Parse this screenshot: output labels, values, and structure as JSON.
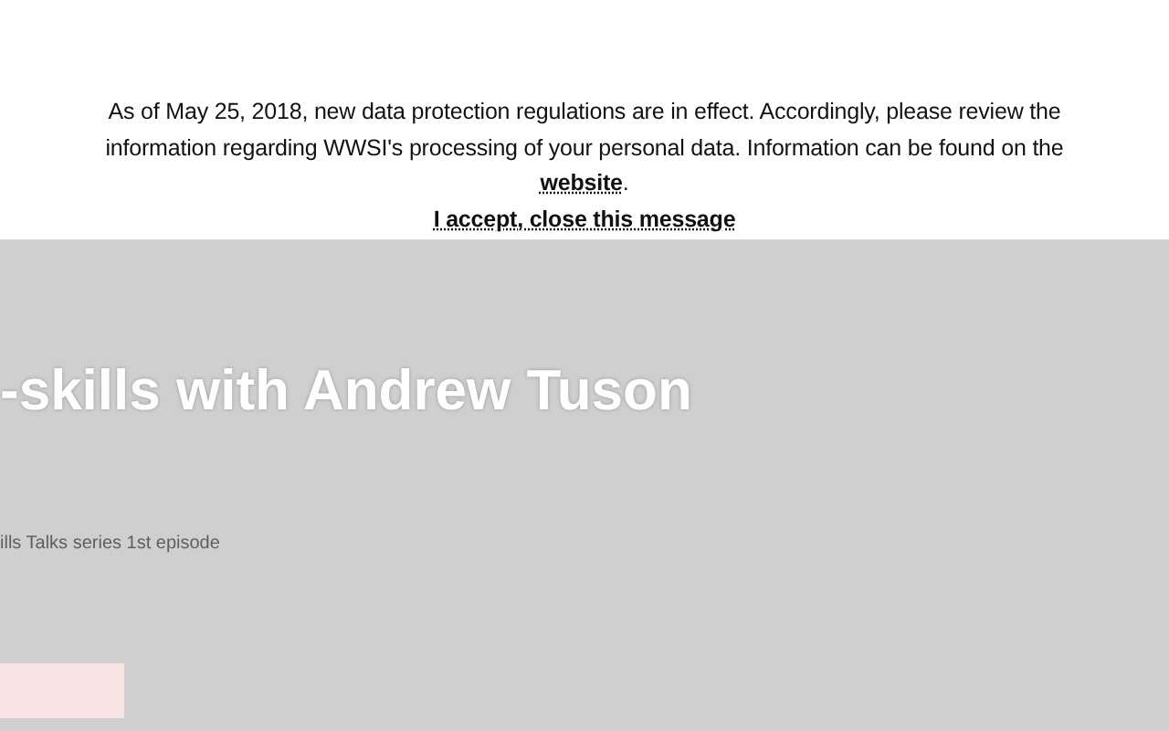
{
  "notice": {
    "text": "As of May 25, 2018, new data protection regulations are in effect. Accordingly, please review the information regarding WWSI's processing of your personal data. Information can be found on the",
    "link": "website",
    "end": ".",
    "accept": "I accept, close this message"
  },
  "hero": {
    "title": "-skills with Andrew Tuson",
    "subtitle": "ills Talks series 1st episode"
  }
}
